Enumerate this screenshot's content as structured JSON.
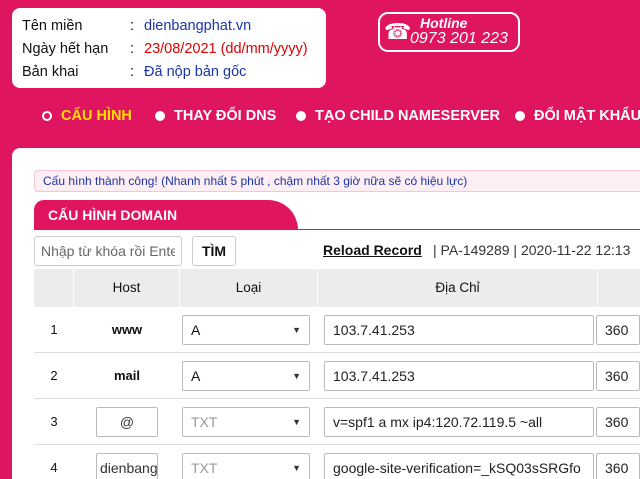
{
  "info": {
    "domain_label": "Tên miền",
    "domain_value": "dienbangphat.vn",
    "expiry_label": "Ngày hết hạn",
    "expiry_value": "23/08/2021 (dd/mm/yyyy)",
    "copy_label": "Bản khai",
    "copy_value": "Đã nộp bản gốc",
    "colon": ":"
  },
  "hotline": {
    "title": "Hotline",
    "number": "0973 201 223",
    "phone_icon": "☎"
  },
  "nav": {
    "items": [
      {
        "label": "CẤU HÌNH"
      },
      {
        "label": "THAY ĐỔI DNS"
      },
      {
        "label": "TẠO CHILD NAMESERVER"
      },
      {
        "label": "ĐỔI MẬT KHẨU"
      }
    ]
  },
  "alert": "Cấu hình thành công! (Nhanh nhất 5 phút , chậm nhất 3 giờ nữa sẽ có hiệu lực)",
  "section_title": "CẤU HÌNH DOMAIN",
  "search": {
    "placeholder": "Nhập từ khóa rồi Enter",
    "button": "TÌM"
  },
  "reload": "Reload Record",
  "meta": "|   PA-149289 | 2020-11-22 12:13",
  "table": {
    "headers": [
      "Host",
      "Loại",
      "Địa Chỉ"
    ],
    "rows": [
      {
        "num": "1",
        "host": "www",
        "type": "A",
        "address": "103.7.41.253",
        "ttl": "360"
      },
      {
        "num": "2",
        "host": "mail",
        "type": "A",
        "address": "103.7.41.253",
        "ttl": "360"
      },
      {
        "num": "3",
        "host": "@",
        "type": "TXT",
        "address": "v=spf1 a mx ip4:120.72.119.5 ~all",
        "ttl": "360"
      },
      {
        "num": "4",
        "host": "dienbangphat",
        "type": "TXT",
        "address": "google-site-verification=_kSQ03sSRGfo",
        "ttl": "360"
      }
    ]
  },
  "colors": {
    "brand": "#e0155f",
    "active_nav": "#ffe000",
    "info_blue": "#1a35a8",
    "info_red": "#e10000"
  },
  "icons": {
    "caret": "▼"
  }
}
